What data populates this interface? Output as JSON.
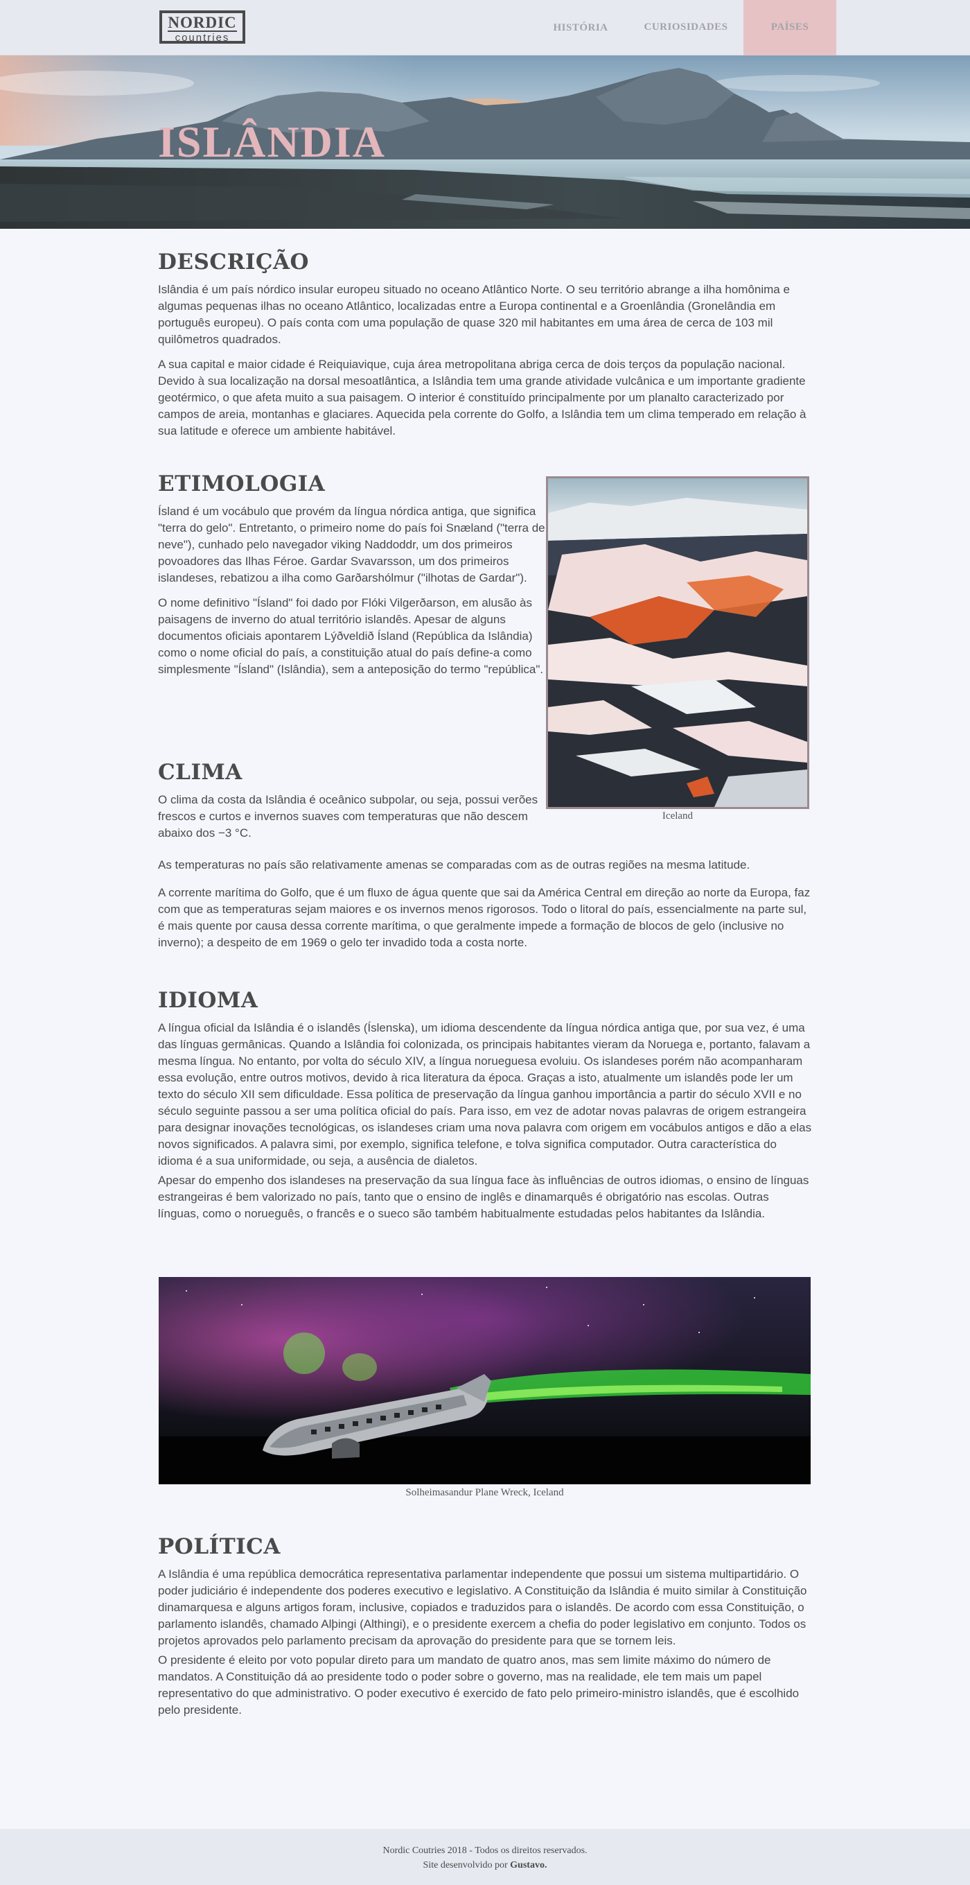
{
  "header": {
    "logo_line1": "NORDIC",
    "logo_line2": "countries",
    "nav": [
      "HISTÓRIA",
      "CURIOSIDADES",
      "PAÍSES"
    ],
    "active_nav": "PAÍSES"
  },
  "hero": {
    "title": "ISLÂNDIA"
  },
  "sections": {
    "descricao": {
      "title": "DESCRIÇÃO",
      "p1": "Islândia é um país nórdico insular europeu situado no oceano Atlântico Norte. O seu território abrange a ilha homônima e algumas pequenas ilhas no oceano Atlântico, localizadas entre a Europa continental e a Groenlândia (Gronelândia em português europeu). O país conta com uma população de quase 320 mil habitantes em uma área de cerca de 103 mil quilômetros quadrados.",
      "p2": "A sua capital e maior cidade é Reiquiavique, cuja área metropolitana abriga cerca de dois terços da população nacional. Devido à sua localização na dorsal mesoatlântica, a Islândia tem uma grande atividade vulcânica e um importante gradiente geotérmico, o que afeta muito a sua paisagem. O interior é constituído principalmente por um planalto caracterizado por campos de areia, montanhas e glaciares. Aquecida pela corrente do Golfo, a Islândia tem um clima temperado em relação à sua latitude e oferece um ambiente habitável."
    },
    "etimologia": {
      "title": "ETIMOLOGIA",
      "p1": "Ísland é um vocábulo que provém da língua nórdica antiga, que significa \"terra do gelo\". Entretanto, o primeiro nome do país foi Snæland (\"terra de neve\"), cunhado pelo navegador viking Naddoddr, um dos primeiros povoadores das Ilhas Féroe. Gardar Svavarsson, um dos primeiros islandeses, rebatizou a ilha como Garðarshólmur (\"ilhotas de Gardar\").",
      "p2": "O nome definitivo \"Ísland\" foi dado por Flóki Vilgerðarson, em alusão às paisagens de inverno do atual território islandês. Apesar de alguns documentos oficiais apontarem Lýðveldið Ísland (República da Islândia) como o nome oficial do país, a constituição atual do país define-a como simplesmente \"Ísland\" (Islândia), sem a anteposição do termo \"república\"."
    },
    "figure1": {
      "caption": "Iceland"
    },
    "clima": {
      "title": "CLIMA",
      "p1": "O clima da costa da Islândia é oceânico subpolar, ou seja, possui verões frescos e curtos e invernos suaves com temperaturas que não descem abaixo dos −3 °C.",
      "p2": "As temperaturas no país são relativamente amenas se comparadas com as de outras regiões na mesma latitude.",
      "p3": "A corrente marítima do Golfo, que é um fluxo de água quente que sai da América Central em direção ao norte da Europa, faz com que as temperaturas sejam maiores e os invernos menos rigorosos. Todo o litoral do país, essencialmente na parte sul, é mais quente por causa dessa corrente marítima, o que geralmente impede a formação de blocos de gelo (inclusive no inverno); a despeito de em 1969 o gelo ter invadido toda a costa norte."
    },
    "idioma": {
      "title": "IDIOMA",
      "p1": "A língua oficial da Islândia é o islandês (Íslenska), um idioma descendente da língua nórdica antiga que, por sua vez, é uma das línguas germânicas. Quando a Islândia foi colonizada, os principais habitantes vieram da Noruega e, portanto, falavam a mesma língua. No entanto, por volta do século XIV, a língua norueguesa evoluiu. Os islandeses porém não acompanharam essa evolução, entre outros motivos, devido à rica literatura da época. Graças a isto, atualmente um islandês pode ler um texto do século XII sem dificuldade. Essa política de preservação da língua ganhou importância a partir do século XVII e no século seguinte passou a ser uma política oficial do país. Para isso, em vez de adotar novas palavras de origem estrangeira para designar inovações tecnológicas, os islandeses criam uma nova palavra com origem em vocábulos antigos e dão a elas novos significados. A palavra simi, por exemplo, significa telefone, e tolva significa computador. Outra característica do idioma é a sua uniformidade, ou seja, a ausência de dialetos.",
      "p2": "Apesar do empenho dos islandeses na preservação da sua língua face às influências de outros idiomas, o ensino de línguas estrangeiras é bem valorizado no país, tanto que o ensino de inglês e dinamarquês é obrigatório nas escolas. Outras línguas, como o norueguês, o francês e o sueco são também habitualmente estudadas pelos habitantes da Islândia."
    },
    "figure2": {
      "caption": "Solheimasandur Plane Wreck, Iceland"
    },
    "politica": {
      "title": "POLÍTICA",
      "p1": "A Islândia é uma república democrática representativa parlamentar independente que possui um sistema multipartidário. O poder judiciário é independente dos poderes executivo e legislativo. A Constituição da Islândia é muito similar à Constituição dinamarquesa e alguns artigos foram, inclusive, copiados e traduzidos para o islandês. De acordo com essa Constituição, o parlamento islandês, chamado Alþingi (Althingi), e o presidente exercem a chefia do poder legislativo em conjunto. Todos os projetos aprovados pelo parlamento precisam da aprovação do presidente para que se tornem leis.",
      "p2": "O presidente é eleito por voto popular direto para um mandato de quatro anos, mas sem limite máximo do número de mandatos. A Constituição dá ao presidente todo o poder sobre o governo, mas na realidade, ele tem mais um papel representativo do que administrativo. O poder executivo é exercido de fato pelo primeiro-ministro islandês, que é escolhido pelo presidente."
    }
  },
  "footer": {
    "line1": "Nordic Coutries 2018 - Todos os direitos reservados.",
    "line2_prefix": "Site desenvolvido por ",
    "author": "Gustavo."
  },
  "colors": {
    "header_bg": "#e7e9f0",
    "page_bg": "#f4f6fb",
    "accent_pink": "#e6c2c4",
    "text": "#4a4a4a",
    "nav_text": "#a3a3a8"
  }
}
